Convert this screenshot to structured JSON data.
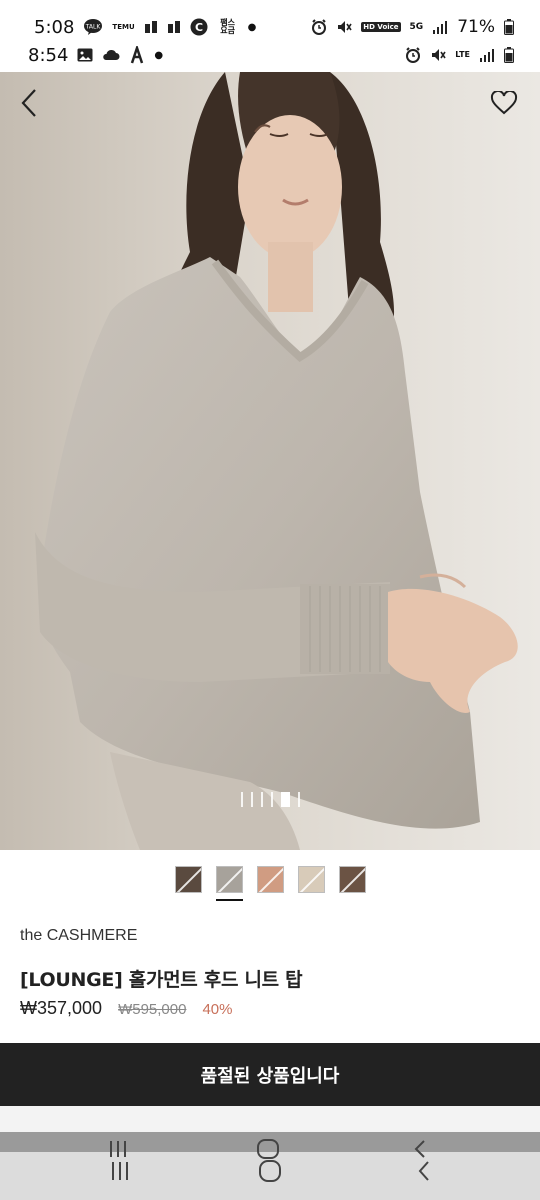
{
  "status_bar_1": {
    "time": "5:08",
    "app_chip_1": "TALK",
    "app_chip_2": "TEMU",
    "app_chip_3": "C",
    "app_chip_4": "팸스 요금",
    "hd_chip": "HD Voice",
    "network_chip": "5G",
    "battery": "71%"
  },
  "status_bar_2": {
    "time": "8:54",
    "network_chip": "LTE"
  },
  "product": {
    "brand": "the CASHMERE",
    "title": "[LOUNGE] 홀가먼트 후드 니트 탑",
    "price": "₩357,000",
    "original_price": "₩595,000",
    "discount": "40%"
  },
  "gallery": {
    "page_count": 6,
    "active_index": 4
  },
  "swatches": [
    {
      "color": "#5a4a3f",
      "selected": false
    },
    {
      "color": "#a7a29b",
      "selected": true
    },
    {
      "color": "#d09c82",
      "selected": false
    },
    {
      "color": "#d8cbb9",
      "selected": false
    },
    {
      "color": "#6b5344",
      "selected": false
    }
  ],
  "cta": {
    "label": "품절된 상품입니다"
  },
  "colors": {
    "cta_bg": "#222222",
    "discount": "#c8705a"
  }
}
